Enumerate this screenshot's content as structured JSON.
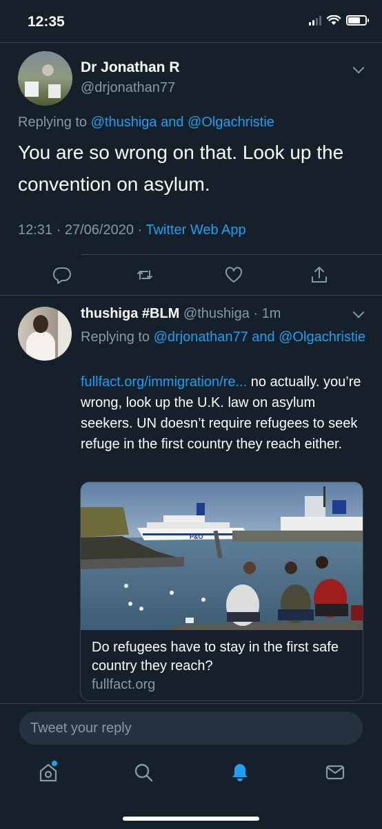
{
  "status": {
    "time": "12:35"
  },
  "main_tweet": {
    "author_name": "Dr Jonathan R",
    "author_handle": "@drjonathan77",
    "replying_prefix": "Replying to ",
    "replying_to": "@thushiga and @Olgachristie",
    "text": "You are so wrong on that. Look up the convention on asylum.",
    "time": "12:31",
    "date": "27/06/2020",
    "source": "Twitter Web App",
    "actions": [
      "reply-icon",
      "retweet-icon",
      "like-icon",
      "share-icon"
    ]
  },
  "reply_tweet": {
    "author_name": "thushiga #BLM",
    "author_handle": "@thushiga",
    "time_ago": "1m",
    "replying_prefix": "Replying to ",
    "replying_to": "@drjonathan77 and @Olgachristie",
    "link_text": "fullfact.org/immigration/re...",
    "body_text": " no actually. you’re wrong, look up the U.K. law on asylum seekers. UN doesn’t require refugees to seek refuge in the first country they reach either.",
    "card": {
      "image_icon": "ferry-harbour-photo",
      "ship_label": "P&O",
      "title": "Do refugees have to stay in the first safe country they reach?",
      "domain": "fullfact.org"
    }
  },
  "compose": {
    "placeholder": "Tweet your reply"
  },
  "tabbar": {
    "items": [
      "home-icon",
      "search-icon",
      "notifications-icon",
      "messages-icon"
    ],
    "active": "notifications-icon",
    "accent": "#1da1f2"
  },
  "colors": {
    "background": "#15202b",
    "muted": "#8899a6",
    "link": "#1da1f2",
    "divider": "#38444d"
  }
}
